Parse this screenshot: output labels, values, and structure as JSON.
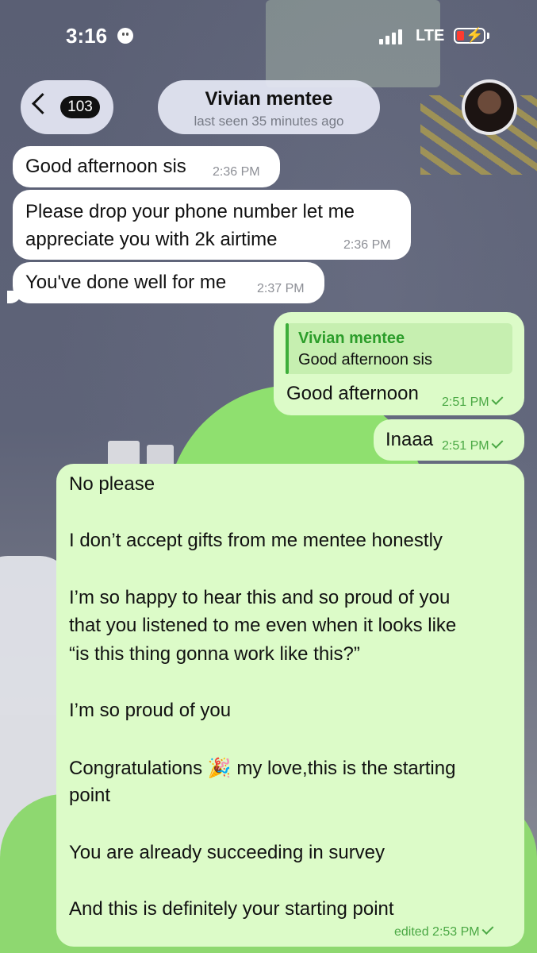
{
  "status_bar": {
    "time": "3:16",
    "network": "LTE",
    "battery_color": "#ff3b30"
  },
  "header": {
    "back_badge": "103",
    "title": "Vivian mentee",
    "subtitle": "last seen 35 minutes ago"
  },
  "colors": {
    "outgoing_bubble": "#dcfbc8",
    "incoming_bubble": "#ffffff",
    "accent_green": "#2c9d2a"
  },
  "messages": [
    {
      "direction": "in",
      "text": "Good afternoon sis",
      "time": "2:36 PM"
    },
    {
      "direction": "in",
      "lines": [
        "Please drop your phone number let me",
        "appreciate you with 2k airtime"
      ],
      "time": "2:36 PM"
    },
    {
      "direction": "in",
      "text": "You've done well for me",
      "time": "2:37 PM"
    },
    {
      "direction": "out",
      "reply_to": {
        "author": "Vivian mentee",
        "text": "Good afternoon sis"
      },
      "text": "Good afternoon",
      "time": "2:51 PM"
    },
    {
      "direction": "out",
      "text": "Inaaa",
      "time": "2:51 PM"
    },
    {
      "direction": "out",
      "lines": [
        "No please",
        "I don’t accept gifts from me mentee honestly",
        "I’m so happy to hear this and so proud of you",
        "that you listened to me even when it looks like",
        "“is this thing gonna work like this?”",
        "I’m so proud of you",
        "Congratulations",
        "my love,this is the starting",
        "point",
        "You are already succeeding in survey",
        "And this is definitely your starting point"
      ],
      "emoji": "🎉",
      "time": "edited 2:53 PM"
    }
  ]
}
